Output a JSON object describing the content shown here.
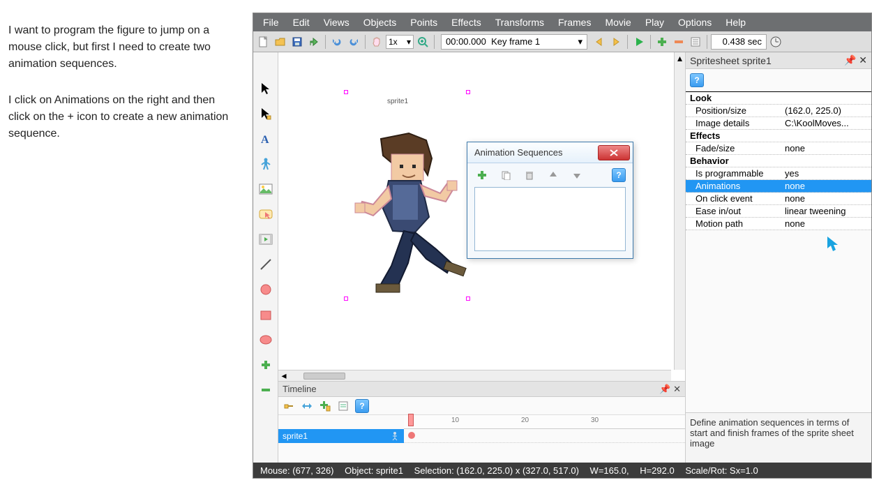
{
  "instructions": {
    "p1": "I want to program the figure to jump on a mouse click, but first I need to create two animation sequences.",
    "p2": "I click on Animations on the right and then click on the + icon to create a new animation sequence."
  },
  "menu": [
    "File",
    "Edit",
    "Views",
    "Objects",
    "Points",
    "Effects",
    "Transforms",
    "Frames",
    "Movie",
    "Play",
    "Options",
    "Help"
  ],
  "toolbar": {
    "zoom": "1x",
    "frame_time": "00:00.000",
    "frame_label": "Key frame 1",
    "duration": "0.438 sec"
  },
  "canvas": {
    "sprite_label": "sprite1"
  },
  "dialog": {
    "title": "Animation Sequences"
  },
  "panel": {
    "title": "Spritesheet sprite1",
    "groups": [
      {
        "label": "Look",
        "rows": [
          {
            "label": "Position/size",
            "value": "(162.0, 225.0)"
          },
          {
            "label": "Image details",
            "value": "C:\\KoolMoves..."
          }
        ]
      },
      {
        "label": "Effects",
        "rows": [
          {
            "label": "Fade/size",
            "value": "none"
          }
        ]
      },
      {
        "label": "Behavior",
        "rows": [
          {
            "label": "Is programmable",
            "value": "yes"
          },
          {
            "label": "Animations",
            "value": "none",
            "selected": true
          },
          {
            "label": "On click event",
            "value": "none"
          },
          {
            "label": "Ease in/out",
            "value": "linear tweening"
          },
          {
            "label": "Motion path",
            "value": "none"
          }
        ]
      }
    ],
    "hint": "Define animation sequences in terms of start and finish frames of the sprite sheet image"
  },
  "timeline": {
    "title": "Timeline",
    "ruler_marks": [
      "10",
      "20",
      "30"
    ],
    "row_label": "sprite1"
  },
  "status": {
    "mouse": "Mouse: (677, 326)",
    "object": "Object: sprite1",
    "selection": "Selection: (162.0, 225.0) x (327.0, 517.0)",
    "w": "W=165.0,",
    "h": "H=292.0",
    "scale": "Scale/Rot: Sx=1.0"
  }
}
